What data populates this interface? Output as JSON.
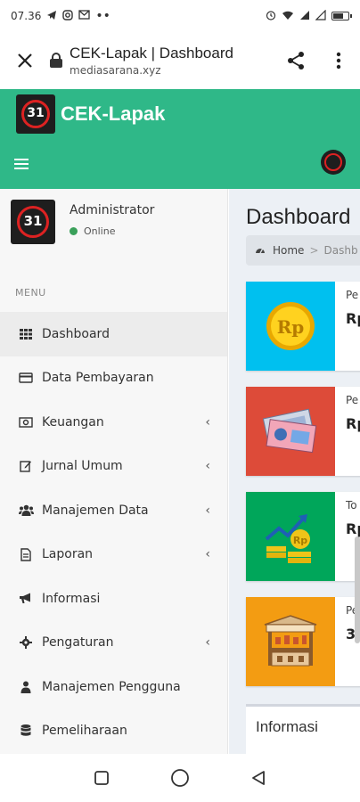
{
  "status_bar": {
    "time": "07.36",
    "left_icons": [
      "telegram-icon",
      "instagram-icon",
      "gmail-icon",
      "more-dots-icon"
    ],
    "right_icons": [
      "alarm-icon",
      "wifi-icon",
      "signal-icon",
      "signal-icon",
      "battery-icon"
    ],
    "battery_level": 0.75
  },
  "browser": {
    "page_title": "CEK-Lapak | Dashboard",
    "url": "mediasarana.xyz"
  },
  "header": {
    "brand": "CEK-Lapak",
    "logo_number": "31",
    "color": "#2fb888"
  },
  "sidebar": {
    "user_name": "Administrator",
    "user_status": "Online",
    "menu_header": "MENU",
    "items": [
      {
        "label": "Dashboard",
        "icon": "grid-icon",
        "active": true,
        "has_submenu": false
      },
      {
        "label": "Data Pembayaran",
        "icon": "credit-card-icon",
        "active": false,
        "has_submenu": false
      },
      {
        "label": "Keuangan",
        "icon": "money-icon",
        "active": false,
        "has_submenu": true
      },
      {
        "label": "Jurnal Umum",
        "icon": "edit-icon",
        "active": false,
        "has_submenu": true
      },
      {
        "label": "Manajemen Data",
        "icon": "users-icon",
        "active": false,
        "has_submenu": true
      },
      {
        "label": "Laporan",
        "icon": "file-icon",
        "active": false,
        "has_submenu": true
      },
      {
        "label": "Informasi",
        "icon": "bullhorn-icon",
        "active": false,
        "has_submenu": false
      },
      {
        "label": "Pengaturan",
        "icon": "gear-icon",
        "active": false,
        "has_submenu": true
      },
      {
        "label": "Manajemen Pengguna",
        "icon": "user-icon",
        "active": false,
        "has_submenu": false
      },
      {
        "label": "Pemeliharaan",
        "icon": "database-icon",
        "active": false,
        "has_submenu": false
      }
    ]
  },
  "main": {
    "title": "Dashboard",
    "breadcrumb": {
      "home": "Home",
      "current": "Dashb"
    },
    "info_boxes": [
      {
        "label": "Pe",
        "value": "Rp",
        "color": "#00c0ef",
        "icon": "coin-icon"
      },
      {
        "label": "Pe",
        "value": "Rp",
        "color": "#dd4b39",
        "icon": "banknotes-icon"
      },
      {
        "label": "To",
        "value": "Rp",
        "color": "#00a65a",
        "icon": "money-growth-icon"
      },
      {
        "label": "Pe",
        "value": "3",
        "color": "#f39c12",
        "icon": "market-stall-icon"
      }
    ],
    "panel_title": "Informasi"
  }
}
